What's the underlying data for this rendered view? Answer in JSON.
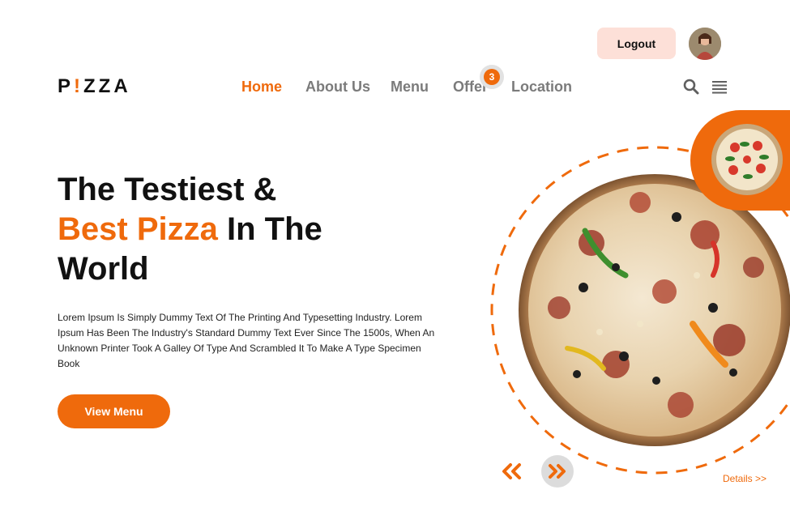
{
  "header": {
    "logout_label": "Logout",
    "logo_parts": [
      "P",
      "!",
      "ZZA"
    ]
  },
  "nav": {
    "items": [
      {
        "label": "Home",
        "active": true
      },
      {
        "label": "About Us",
        "active": false
      },
      {
        "label": "Menu",
        "active": false
      },
      {
        "label": "Offer",
        "active": false
      },
      {
        "label": "Location",
        "active": false
      }
    ],
    "offer_badge": "3"
  },
  "icons": {
    "search": "search-icon",
    "menu": "hamburger-menu-icon",
    "prev": "double-chevron-left-icon",
    "next": "double-chevron-right-icon"
  },
  "hero": {
    "title_line1": "The Testiest &",
    "title_highlight": "Best Pizza",
    "title_line2_rest": " In The",
    "title_line3": "World",
    "description": "Lorem Ipsum Is Simply Dummy Text Of The Printing And Typesetting Industry. Lorem Ipsum Has Been The Industry's Standard Dummy Text Ever Since The 1500s, When An Unknown Printer Took A Galley Of Type And Scrambled It To Make A Type Specimen Book",
    "cta_label": "View Menu"
  },
  "carousel": {
    "details_label": "Details >>"
  },
  "colors": {
    "accent": "#ef6a0c",
    "logout_bg": "#fde0d8",
    "nav_inactive": "#7b7b7b"
  }
}
